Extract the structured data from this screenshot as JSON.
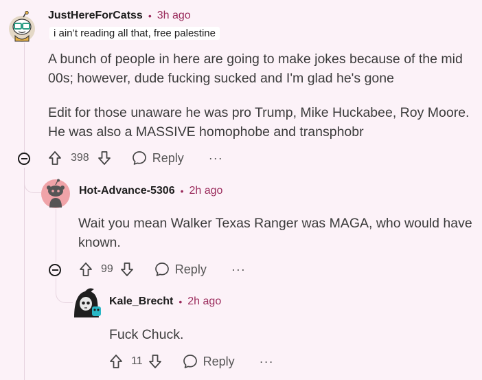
{
  "comments": [
    {
      "username": "JustHereForCatss",
      "time": "3h ago",
      "flair": "i ain’t reading all that, free palestine",
      "paragraphs": [
        "A bunch of people in here are going to make jokes because of the mid 00s; however, dude fucking sucked and I'm glad he's gone",
        "Edit for those unaware he was pro Trump, Mike Huckabee, Roy Moore. He was also a MASSIVE homophobe and transphobr"
      ],
      "votes": "398",
      "reply_label": "Reply",
      "more": "···"
    },
    {
      "username": "Hot-Advance-5306",
      "time": "2h ago",
      "paragraphs": [
        "Wait you mean Walker Texas Ranger was MAGA, who would have known."
      ],
      "votes": "99",
      "reply_label": "Reply",
      "more": "···"
    },
    {
      "username": "Kale_Brecht",
      "time": "2h ago",
      "paragraphs": [
        "Fuck Chuck."
      ],
      "votes": "11",
      "reply_label": "Reply",
      "more": "···"
    }
  ],
  "separator": "•",
  "colors": {
    "background": "#FCF2F8",
    "time": "#9a2a5b",
    "thread_line": "#e6d4df"
  }
}
